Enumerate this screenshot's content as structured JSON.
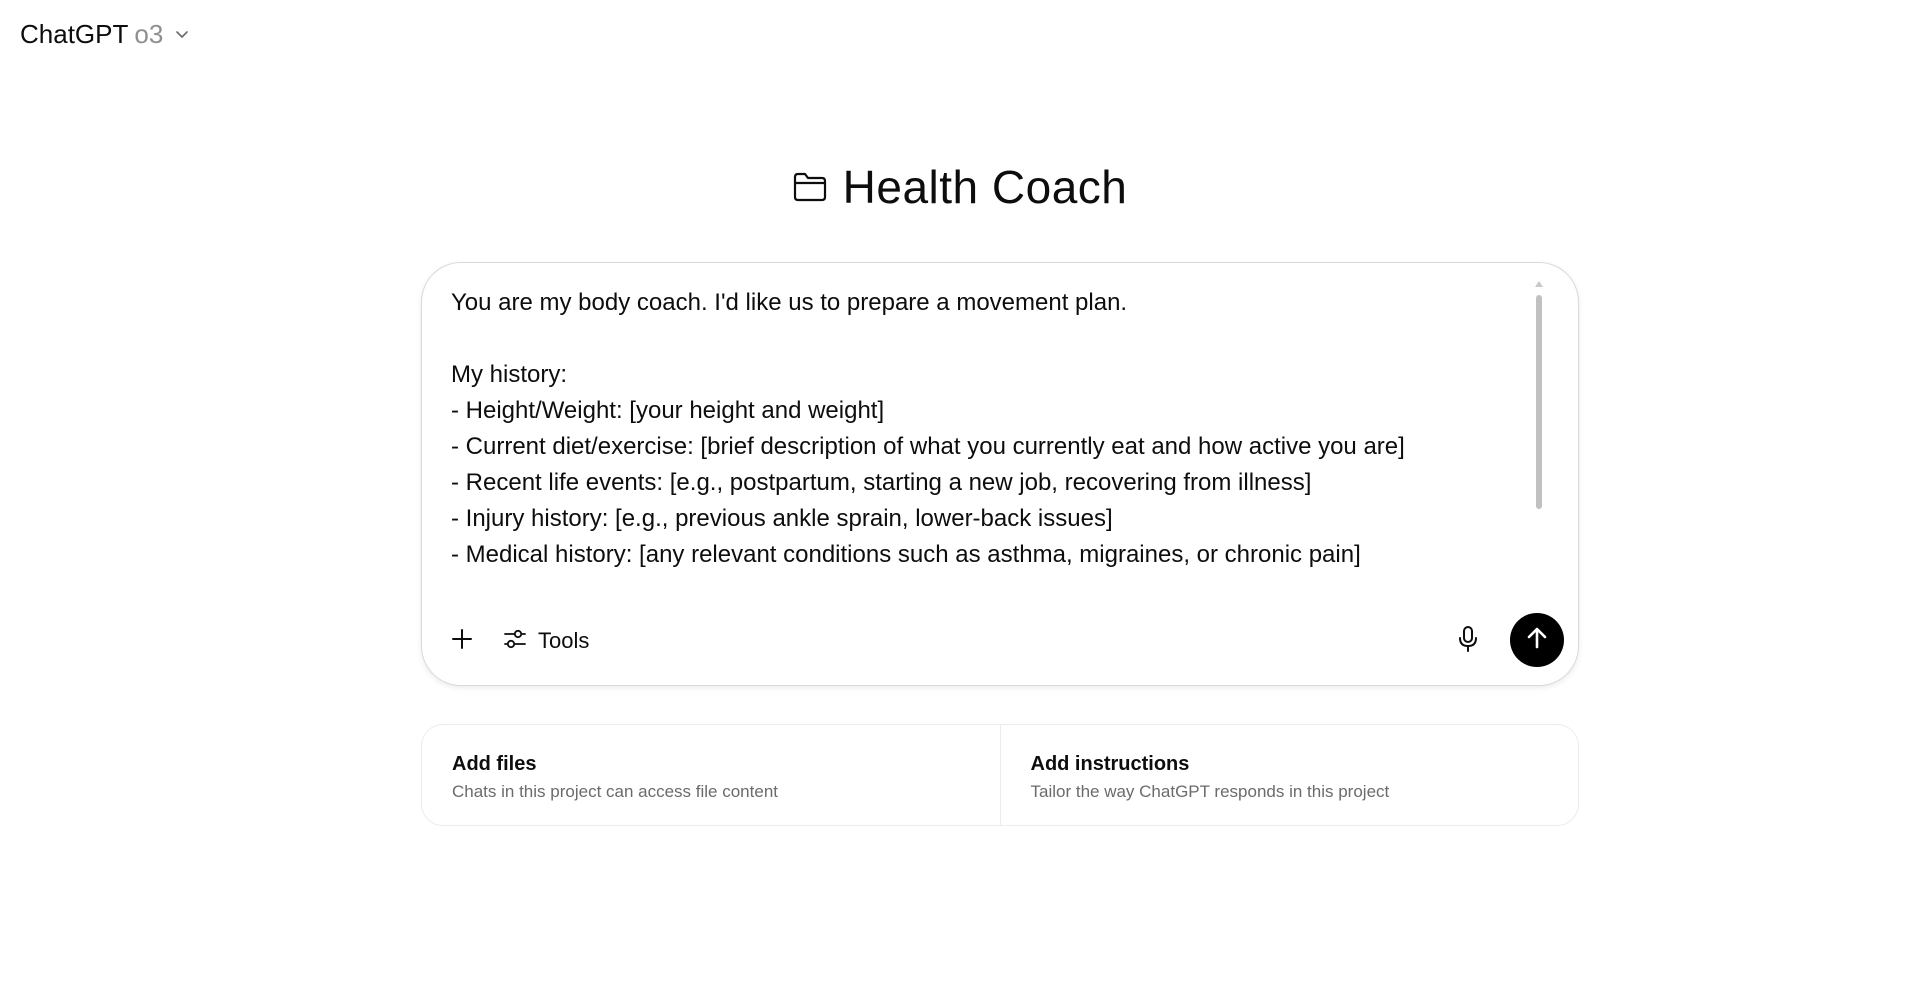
{
  "header": {
    "brand": "ChatGPT",
    "model": "o3",
    "chevron_icon": "chevron-down-icon"
  },
  "project": {
    "title": "Health Coach",
    "icon": "folder-icon"
  },
  "composer": {
    "text": "You are my body coach. I'd like us to prepare a movement plan.\n\nMy history:\n- Height/Weight: [your height and weight]\n- Current diet/exercise: [brief description of what you currently eat and how active you are]\n- Recent life events: [e.g., postpartum, starting a new job, recovering from illness]\n- Injury history: [e.g., previous ankle sprain, lower-back issues]\n- Medical history: [any relevant conditions such as asthma, migraines, or chronic pain]",
    "tools_label": "Tools",
    "icons": {
      "add": "plus-icon",
      "tools": "sliders-icon",
      "mic": "microphone-icon",
      "send": "arrow-up-icon"
    }
  },
  "cards": [
    {
      "title": "Add files",
      "description": "Chats in this project can access file content"
    },
    {
      "title": "Add instructions",
      "description": "Tailor the way ChatGPT responds in this project"
    }
  ]
}
